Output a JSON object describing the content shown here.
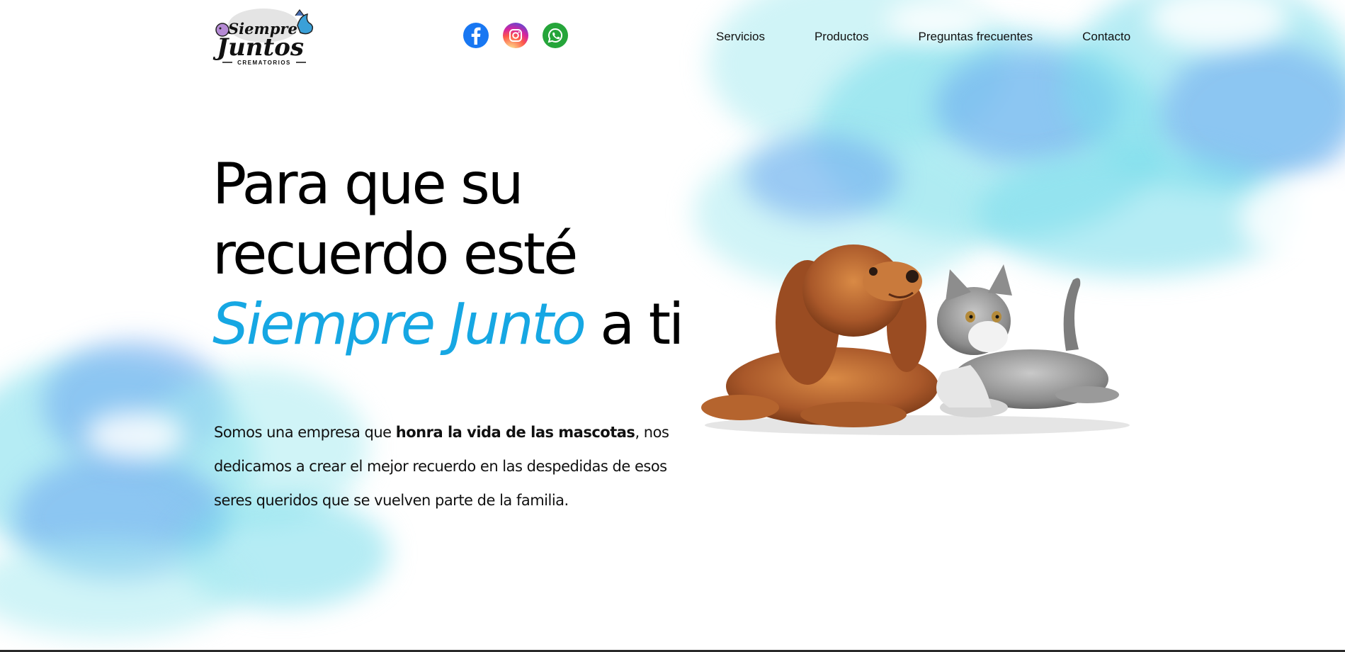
{
  "logo": {
    "brand_top": "Siempre",
    "brand_main": "Juntos",
    "brand_sub": "CREMATORIOS"
  },
  "social": [
    {
      "name": "facebook-icon",
      "color": "#1877f2"
    },
    {
      "name": "instagram-icon",
      "color": "#d62976"
    },
    {
      "name": "whatsapp-icon",
      "color": "#25a53a"
    }
  ],
  "nav": {
    "servicios": "Servicios",
    "productos": "Productos",
    "faq": "Preguntas frecuentes",
    "contacto": "Contacto"
  },
  "hero": {
    "line1": "Para que su",
    "line2": "recuerdo esté",
    "accent": "Siempre Junto",
    "line3_suffix": "a ti",
    "accent_color": "#16a7e3",
    "desc_pre": "Somos una empresa que ",
    "desc_bold": "honra la vida de las mascotas",
    "desc_post": ", nos dedicamos a crear el mejor recuerdo en las despedidas de esos seres queridos que se vuelven parte de la familia."
  }
}
